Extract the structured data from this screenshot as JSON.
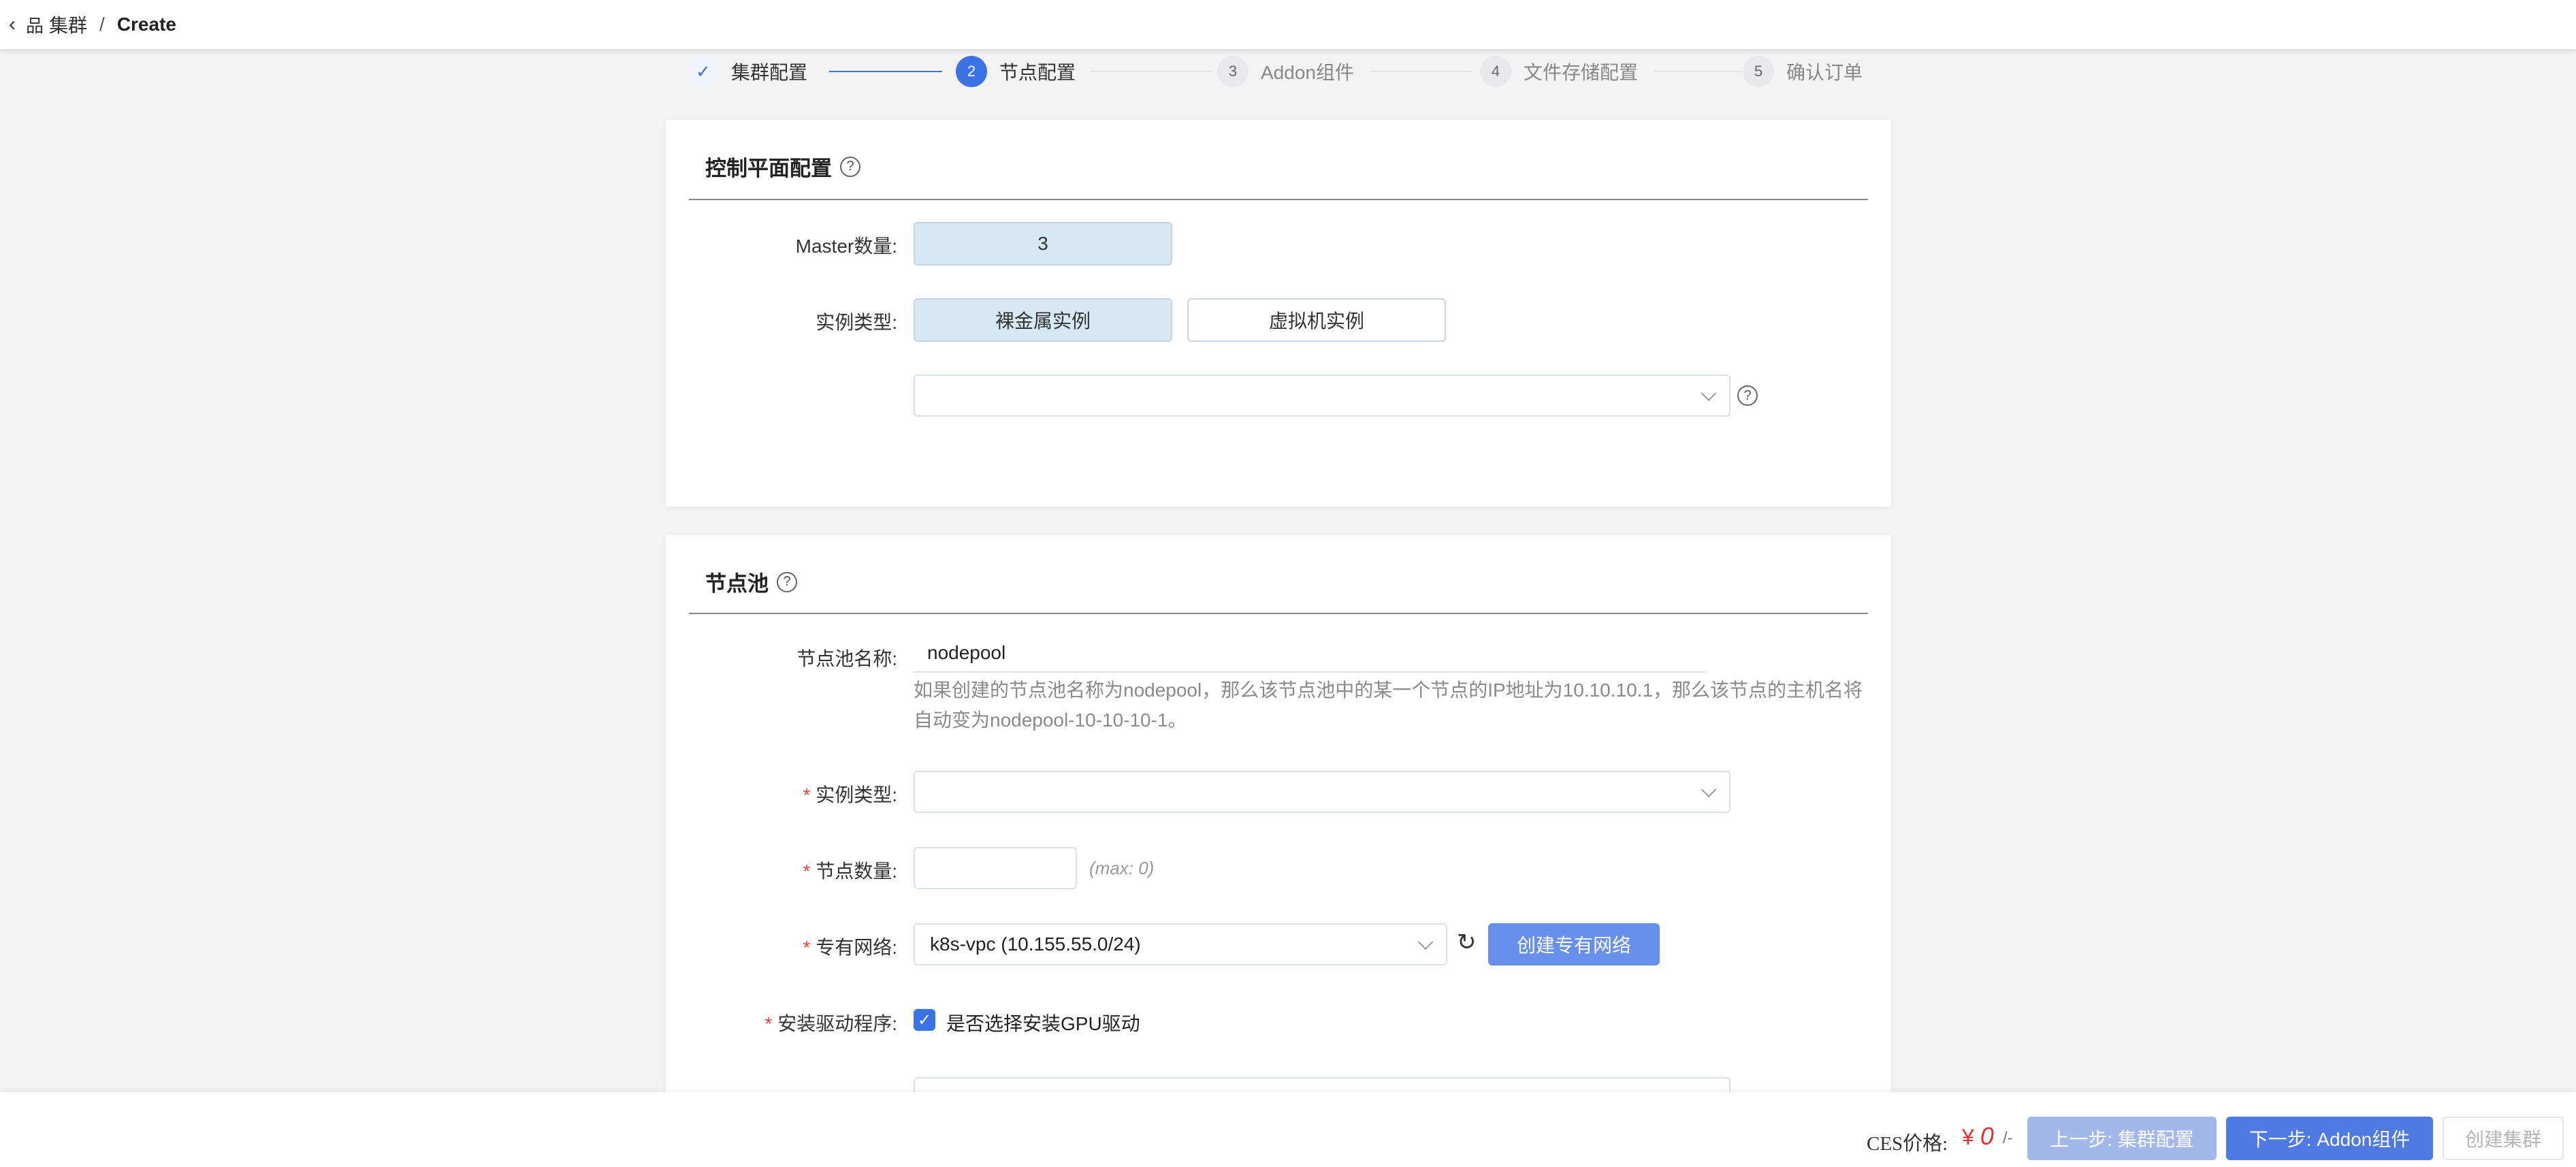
{
  "header": {
    "back_icon": "chevron-left-icon",
    "crumb_icon": "cluster-icon",
    "crumb_label": "集群",
    "separator": "/",
    "current": "Create"
  },
  "steps": [
    {
      "index": "✓",
      "label": "集群配置",
      "state": "done"
    },
    {
      "index": "2",
      "label": "节点配置",
      "state": "active"
    },
    {
      "index": "3",
      "label": "Addon组件",
      "state": "pending"
    },
    {
      "index": "4",
      "label": "文件存储配置",
      "state": "pending"
    },
    {
      "index": "5",
      "label": "确认订单",
      "state": "pending"
    }
  ],
  "control_plane": {
    "title": "控制平面配置",
    "master_count_label": "Master数量:",
    "master_count_value": "3",
    "instance_type_label": "实例类型:",
    "option_baremetal": "裸金属实例",
    "option_vm": "虚拟机实例",
    "selected_option": "裸金属实例",
    "spec_select_value": ""
  },
  "node_pool": {
    "title": "节点池",
    "name_label": "节点池名称:",
    "name_value": "nodepool",
    "name_hint_line1": "如果创建的节点池名称为nodepool，那么该节点池中的某一个节点的IP地址为10.10.10.1，那么该节点的主机名将",
    "name_hint_line2": "自动变为nodepool-10-10-10-1。",
    "required_mark": "*",
    "instance_type_label": "实例类型:",
    "instance_type_value": "",
    "node_count_label": "节点数量:",
    "node_count_value": "",
    "node_count_max": "(max: 0)",
    "vpc_label": "专有网络:",
    "vpc_value": "k8s-vpc (10.155.55.0/24)",
    "create_vpc_button": "创建专有网络",
    "driver_label": "安装驱动程序:",
    "gpu_driver_checkbox_label": "是否选择安装GPU驱动",
    "gpu_driver_checked": true
  },
  "footer": {
    "price_label": "CES价格:",
    "currency": "¥",
    "price_value": "0",
    "price_unit": "/-",
    "prev_button": "上一步: 集群配置",
    "next_button": "下一步: Addon组件",
    "create_button": "创建集群"
  },
  "colors": {
    "primary": "#3b73e6",
    "selected_bg": "#d7e8f5",
    "required": "#e54545",
    "price": "#e53030"
  }
}
